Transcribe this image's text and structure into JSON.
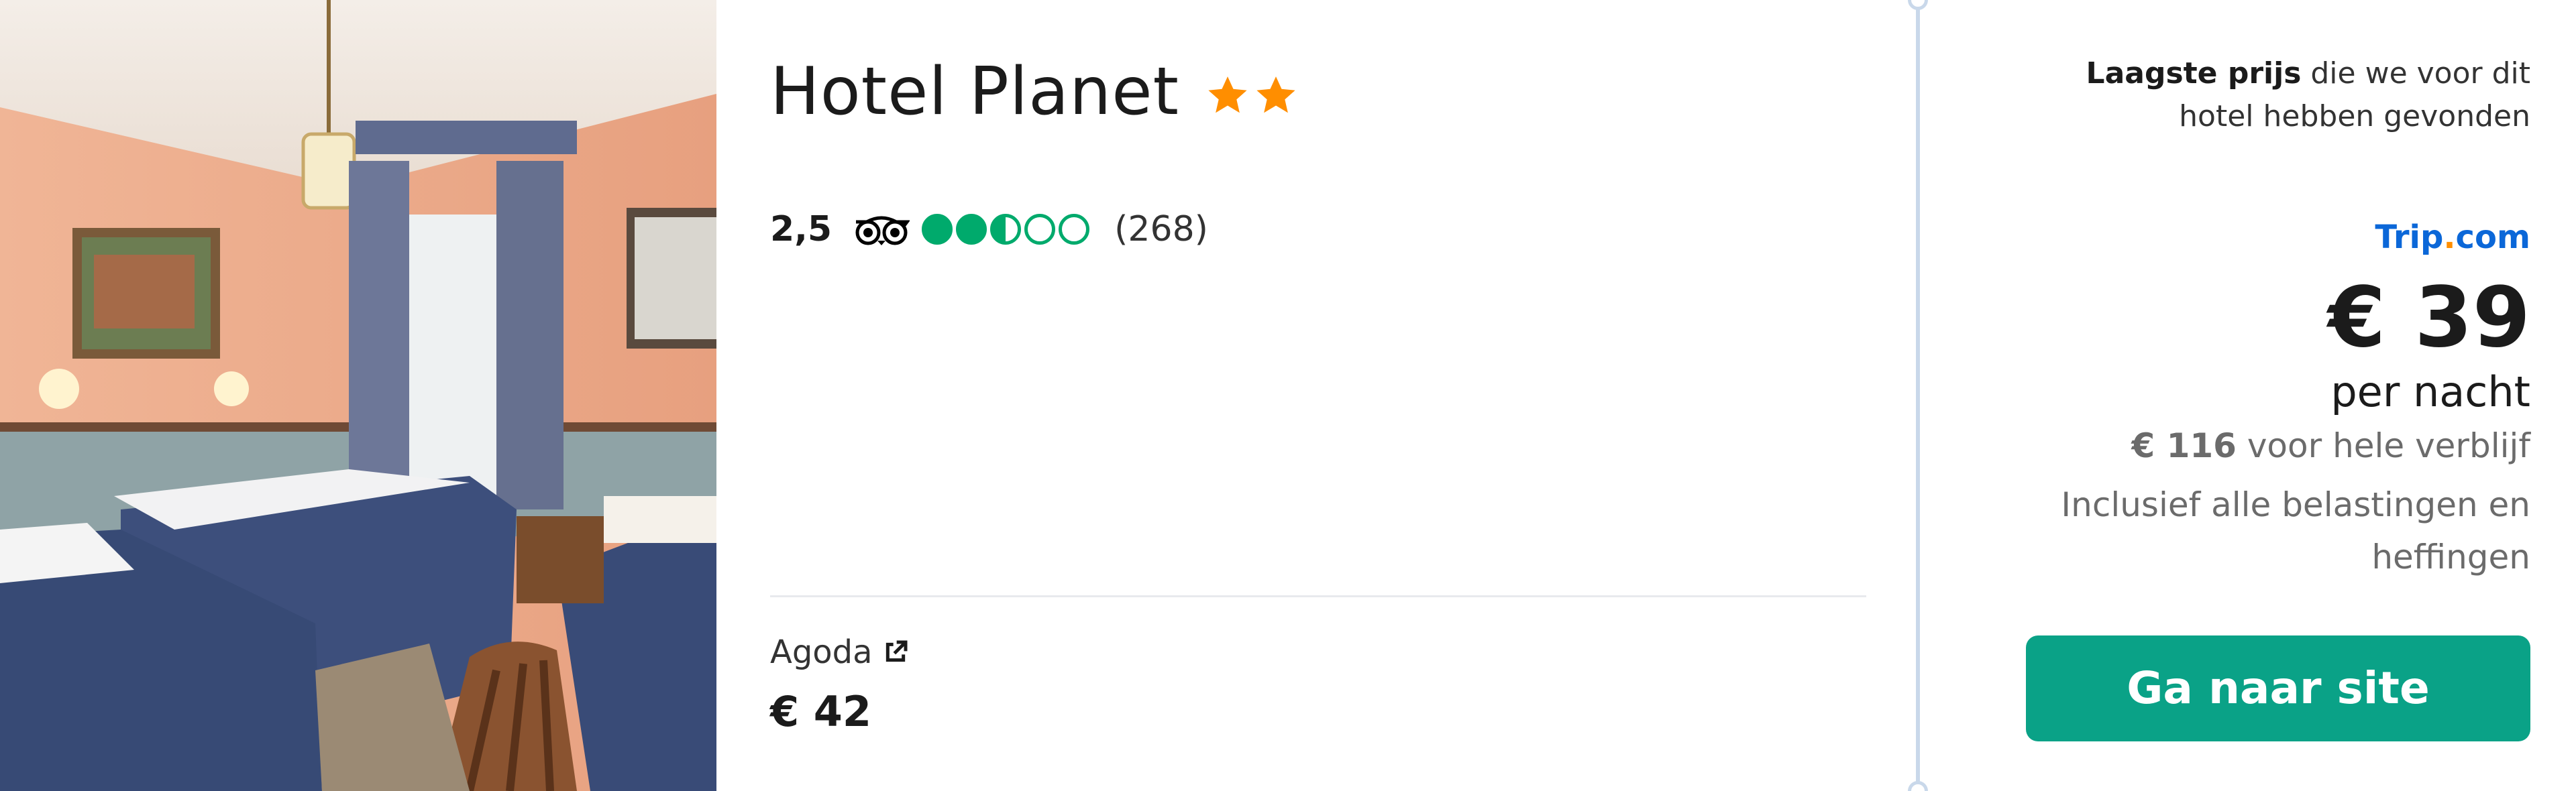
{
  "hotel": {
    "name": "Hotel Planet",
    "star_rating": 2,
    "photo_description_icon": "hotel-room-photo"
  },
  "rating": {
    "score": "2,5",
    "bubbles_filled": 2.5,
    "bubbles_total": 5,
    "review_count": "(268)",
    "icon": "tripadvisor-owl-icon"
  },
  "other_provider": {
    "name": "Agoda",
    "price": "€ 42",
    "icon": "external-link-icon"
  },
  "best_price": {
    "lowest_label_bold": "Laagste prijs",
    "lowest_label_rest": " die we voor dit hotel hebben gevonden",
    "partner_part1": "Trip",
    "partner_dot": ".",
    "partner_part2": "com",
    "price": "€ 39",
    "per_night": "per nacht",
    "total_bold": "€ 116",
    "total_rest": " voor hele verblijf",
    "taxes": "Inclusief alle belastingen en heffingen",
    "cta_label": "Ga naar site"
  },
  "colors": {
    "star": "#ff8e00",
    "bubble": "#00aa6c",
    "cta": "#0aa287",
    "partner_link": "#0b67d8"
  }
}
